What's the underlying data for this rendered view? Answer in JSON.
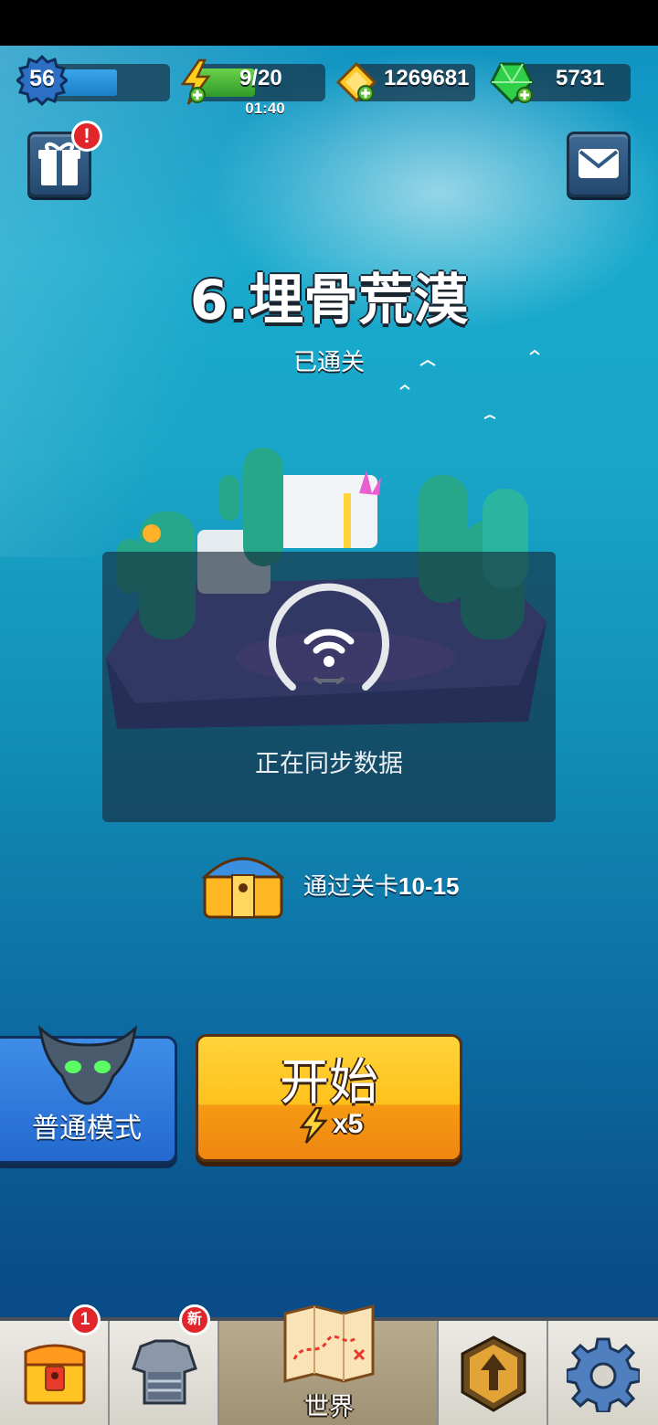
{
  "top_bar": {
    "player_level": "56",
    "level_progress": 0.55,
    "energy": "9/20",
    "energy_fraction": 0.45,
    "energy_timer": "01:40",
    "gold": "1269681",
    "gems": "5731"
  },
  "level": {
    "title": "6.埋骨荒漠",
    "status": "已通关"
  },
  "sync": {
    "message": "正在同步数据"
  },
  "reward": {
    "prefix": "通过关卡",
    "range": "10-15"
  },
  "mode": {
    "label": "普通模式"
  },
  "start": {
    "label": "开始",
    "cost": "x5"
  },
  "nav": {
    "chest_badge": "1",
    "gear_badge": "新",
    "world_label": "世界"
  },
  "colors": {
    "accent_yellow": "#ffc21c",
    "accent_blue": "#2f7fe0",
    "alert_red": "#e0262b",
    "energy_green": "#4bbf3a"
  }
}
